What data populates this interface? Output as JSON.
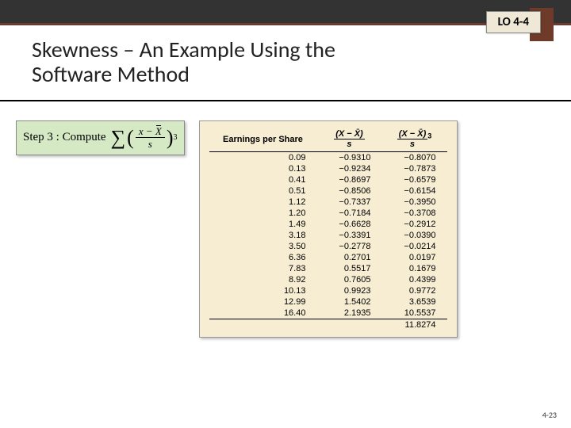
{
  "header": {
    "lo_label": "LO 4-4",
    "title": "Skewness – An Example Using the Software Method"
  },
  "step": {
    "prefix": "Step 3 :",
    "verb": "Compute",
    "numerator_a": "x",
    "numerator_minus": "−",
    "numerator_b": "X",
    "denominator": "s",
    "exponent": "3"
  },
  "table": {
    "headers": {
      "c1": "Earnings per Share",
      "c2_num": "(X − X̄)",
      "c2_den": "s",
      "c3_num": "(X − X̄)",
      "c3_den": "s",
      "c3_exp": "3"
    },
    "rows": [
      {
        "eps": "0.09",
        "z": "−0.9310",
        "z3": "−0.8070"
      },
      {
        "eps": "0.13",
        "z": "−0.9234",
        "z3": "−0.7873"
      },
      {
        "eps": "0.41",
        "z": "−0.8697",
        "z3": "−0.6579"
      },
      {
        "eps": "0.51",
        "z": "−0.8506",
        "z3": "−0.6154"
      },
      {
        "eps": "1.12",
        "z": "−0.7337",
        "z3": "−0.3950"
      },
      {
        "eps": "1.20",
        "z": "−0.7184",
        "z3": "−0.3708"
      },
      {
        "eps": "1.49",
        "z": "−0.6628",
        "z3": "−0.2912"
      },
      {
        "eps": "3.18",
        "z": "−0.3391",
        "z3": "−0.0390"
      },
      {
        "eps": "3.50",
        "z": "−0.2778",
        "z3": "−0.0214"
      },
      {
        "eps": "6.36",
        "z": "0.2701",
        "z3": "0.0197"
      },
      {
        "eps": "7.83",
        "z": "0.5517",
        "z3": "0.1679"
      },
      {
        "eps": "8.92",
        "z": "0.7605",
        "z3": "0.4399"
      },
      {
        "eps": "10.13",
        "z": "0.9923",
        "z3": "0.9772"
      },
      {
        "eps": "12.99",
        "z": "1.5402",
        "z3": "3.6539"
      },
      {
        "eps": "16.40",
        "z": "2.1935",
        "z3": "10.5537"
      }
    ],
    "sum_z3": "11.8274"
  },
  "footer": {
    "slide_num": "4-23"
  },
  "chart_data": {
    "type": "table",
    "title": "Skewness computation table",
    "columns": [
      "Earnings per Share",
      "(X − X̄)/s",
      "((X − X̄)/s)^3"
    ],
    "rows": [
      [
        0.09,
        -0.931,
        -0.807
      ],
      [
        0.13,
        -0.9234,
        -0.7873
      ],
      [
        0.41,
        -0.8697,
        -0.6579
      ],
      [
        0.51,
        -0.8506,
        -0.6154
      ],
      [
        1.12,
        -0.7337,
        -0.395
      ],
      [
        1.2,
        -0.7184,
        -0.3708
      ],
      [
        1.49,
        -0.6628,
        -0.2912
      ],
      [
        3.18,
        -0.3391,
        -0.039
      ],
      [
        3.5,
        -0.2778,
        -0.0214
      ],
      [
        6.36,
        0.2701,
        0.0197
      ],
      [
        7.83,
        0.5517,
        0.1679
      ],
      [
        8.92,
        0.7605,
        0.4399
      ],
      [
        10.13,
        0.9923,
        0.9772
      ],
      [
        12.99,
        1.5402,
        3.6539
      ],
      [
        16.4,
        2.1935,
        10.5537
      ]
    ],
    "sum_cubed": 11.8274
  }
}
